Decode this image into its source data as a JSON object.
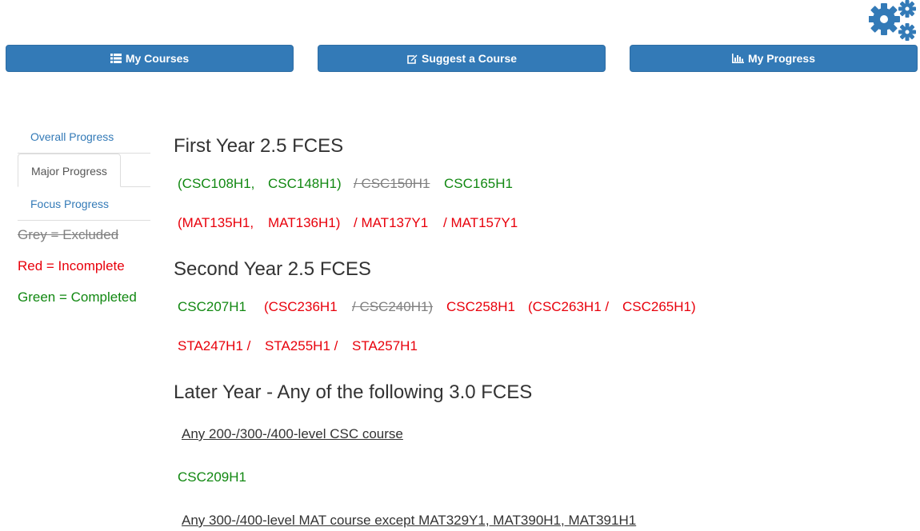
{
  "top_buttons": [
    {
      "label": "My Courses",
      "icon": "list-icon"
    },
    {
      "label": "Suggest a Course",
      "icon": "edit-icon"
    },
    {
      "label": "My Progress",
      "icon": "bar-chart-icon"
    }
  ],
  "sidenav": {
    "items": [
      {
        "label": "Overall Progress"
      },
      {
        "label": "Major Progress"
      },
      {
        "label": "Focus Progress"
      }
    ],
    "active": "Major Progress"
  },
  "legend": {
    "grey": "Grey = Excluded",
    "red": "Red = Incomplete",
    "green": "Green = Completed"
  },
  "colors": {
    "primary": "#337ab7",
    "excluded": "#808080",
    "incomplete": "#e8000b",
    "completed": "#118811"
  },
  "sections": {
    "first": {
      "heading": "First Year 2.5 FCES",
      "row1": {
        "p1": "(CSC108H1,",
        "p2": "CSC148H1)",
        "p3": "/ CSC150H1",
        "p4": "CSC165H1"
      },
      "row2": {
        "p1": "(MAT135H1,",
        "p2": "MAT136H1)",
        "p3": "/ MAT137Y1",
        "p4": "/ MAT157Y1"
      }
    },
    "second": {
      "heading": "Second Year 2.5 FCES",
      "row1": {
        "p1": "CSC207H1",
        "p2": "(CSC236H1",
        "p3": "/ CSC240H1)",
        "p4": "CSC258H1",
        "p5": "(CSC263H1 /",
        "p6": "CSC265H1)"
      },
      "row2": {
        "p1": "STA247H1 /",
        "p2": "STA255H1 /",
        "p3": "STA257H1"
      }
    },
    "later": {
      "heading": "Later Year - Any of the following 3.0 FCES",
      "link1": "Any 200-/300-/400-level CSC course",
      "course1": "CSC209H1",
      "link2": "Any 300-/400-level MAT course except MAT329Y1, MAT390H1, MAT391H1"
    }
  }
}
